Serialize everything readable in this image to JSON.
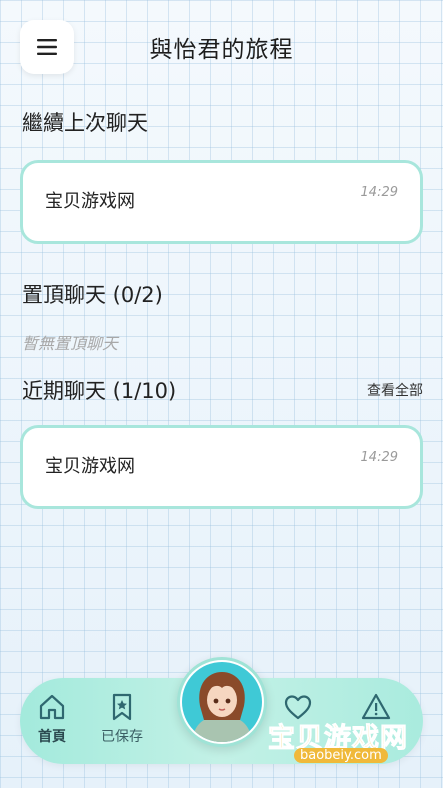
{
  "header": {
    "title": "與怡君的旅程"
  },
  "continue_section": {
    "title": "繼續上次聊天",
    "card": {
      "name": "宝贝游戏网",
      "time": "14:29"
    }
  },
  "pinned_section": {
    "title": "置頂聊天 (0/2)",
    "empty_text": "暫無置頂聊天"
  },
  "recent_section": {
    "title": "近期聊天 (1/10)",
    "view_all": "查看全部",
    "card": {
      "name": "宝贝游戏网",
      "time": "14:29"
    }
  },
  "bottom_nav": {
    "items": [
      {
        "label": "首頁",
        "icon": "home-icon",
        "active": true
      },
      {
        "label": "已保存",
        "icon": "bookmark-icon",
        "active": false
      },
      {
        "label": "",
        "icon": "heart-icon",
        "active": false
      },
      {
        "label": "",
        "icon": "warning-icon",
        "active": false
      }
    ]
  },
  "watermark": {
    "text": "宝贝游戏网",
    "url": "baobeiy.com"
  },
  "colors": {
    "accent": "#a8e6dc",
    "nav_bar": "#b3eee2",
    "muted_text": "#a8a8a8"
  }
}
